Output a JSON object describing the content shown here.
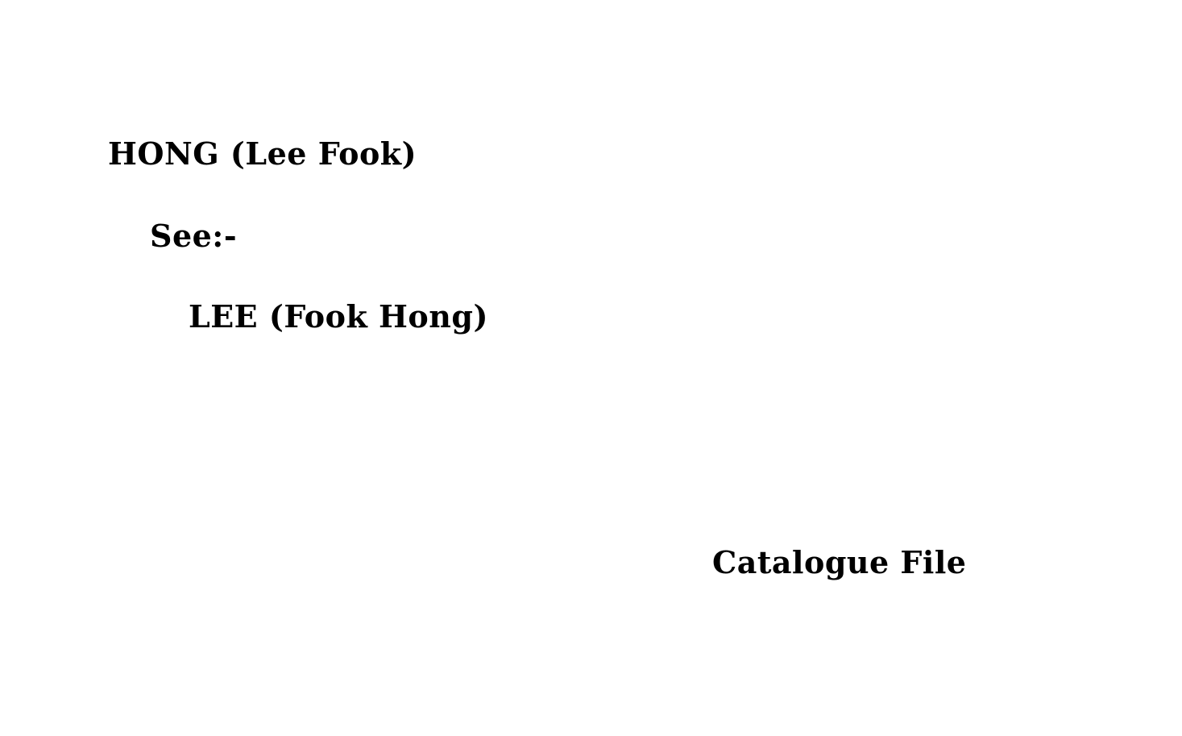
{
  "card": {
    "heading": "HONG (Lee Fook)",
    "see_label": "See:-",
    "cross_reference": "LEE (Fook Hong)",
    "footer": "Catalogue File"
  }
}
